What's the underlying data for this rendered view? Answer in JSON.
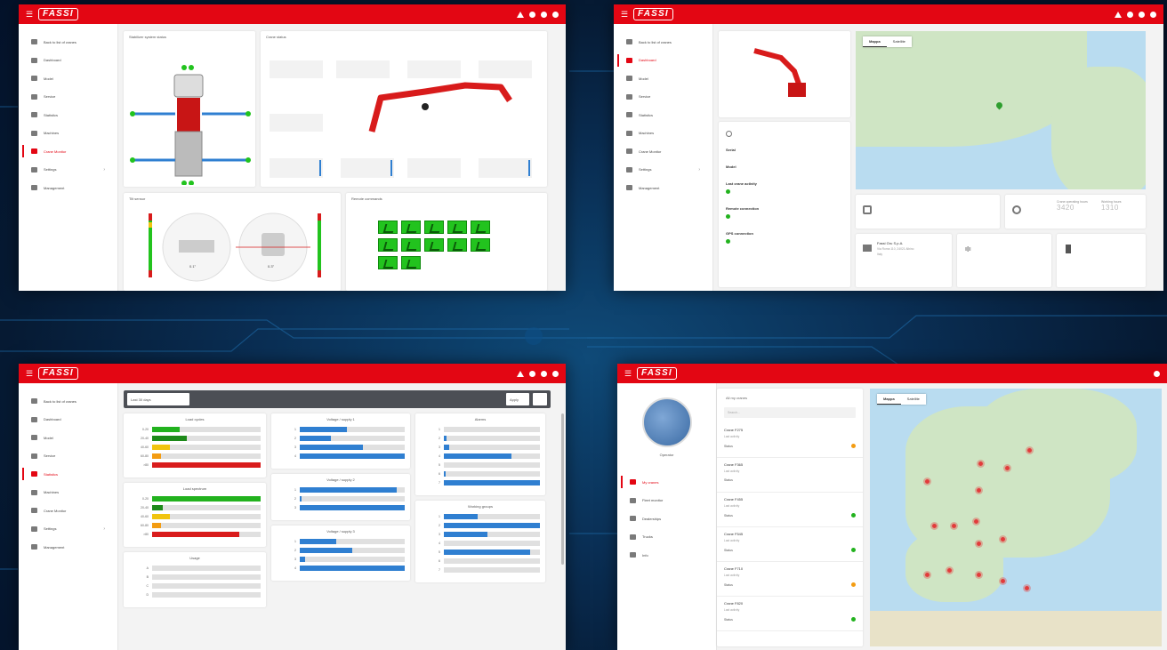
{
  "brand": {
    "logo": "FASSI",
    "accent": "#e30613"
  },
  "sidebar_main": [
    {
      "label": "Back to list of cranes",
      "icon": "arrow-left-icon"
    },
    {
      "label": "Dashboard",
      "icon": "home-icon"
    },
    {
      "label": "Model",
      "icon": "model-icon"
    },
    {
      "label": "Service",
      "icon": "wrench-icon"
    },
    {
      "label": "Statistics",
      "icon": "chart-icon"
    },
    {
      "label": "Machines",
      "icon": "machine-icon"
    },
    {
      "label": "Crane Monitor",
      "icon": "crane-icon"
    },
    {
      "label": "Settings",
      "icon": "gear-icon"
    },
    {
      "label": "Management",
      "icon": "grid-icon"
    }
  ],
  "panel1": {
    "active_item": 6,
    "stabilizer_title": "Stabilizer system status",
    "crane_title": "Crane status",
    "tilt_title": "Tilt sensor",
    "tilt_values": [
      "0.1°",
      "0.3°"
    ],
    "remote_title": "Remote commands"
  },
  "panel2": {
    "active_item": 1,
    "map_tabs": [
      "Mappa",
      "Satellite"
    ],
    "info_labels": [
      "Serial",
      "Model",
      "Last crane activity",
      "Remote connection",
      "GPS connection"
    ],
    "stat_labels": [
      "Crane operating hours",
      "Working hours"
    ],
    "stat_values": [
      "3420",
      "1310"
    ],
    "dealer_title": "Fassi Gru S.p.A.",
    "dealer_lines": [
      "Via Roma 110, 24021 Albino",
      "Italy"
    ]
  },
  "panel3": {
    "active_item": 4,
    "toolbar_input": "Last 30 days",
    "toolbar_btn": "Apply",
    "charts": [
      {
        "title": "Load cycles",
        "rows": [
          {
            "label": "0-20",
            "value": 0.25,
            "color": "#22b21e"
          },
          {
            "label": "20-40",
            "value": 0.32,
            "color": "#1d8a1a"
          },
          {
            "label": "40-60",
            "value": 0.16,
            "color": "#f1c40f"
          },
          {
            "label": "60-80",
            "value": 0.08,
            "color": "#f39c12"
          },
          {
            "label": ">80",
            "value": 1.0,
            "color": "#d91c1c"
          }
        ]
      },
      {
        "title": "Load spectrum",
        "rows": [
          {
            "label": "0-20",
            "value": 1.0,
            "color": "#22b21e"
          },
          {
            "label": "20-40",
            "value": 0.1,
            "color": "#1d8a1a"
          },
          {
            "label": "40-60",
            "value": 0.16,
            "color": "#f1c40f"
          },
          {
            "label": "60-80",
            "value": 0.08,
            "color": "#f39c12"
          },
          {
            "label": ">80",
            "value": 0.8,
            "color": "#d91c1c"
          }
        ]
      },
      {
        "title": "Usage",
        "rows": [
          {
            "label": "A",
            "value": 0.0,
            "color": "#2f7fd1"
          },
          {
            "label": "B",
            "value": 0.0,
            "color": "#2f7fd1"
          },
          {
            "label": "C",
            "value": 0.0,
            "color": "#2f7fd1"
          },
          {
            "label": "D",
            "value": 0.0,
            "color": "#2f7fd1"
          }
        ]
      },
      {
        "title": "Voltage / supply 1",
        "rows": [
          {
            "label": "1",
            "value": 0.45,
            "color": "#2f7fd1"
          },
          {
            "label": "2",
            "value": 0.3,
            "color": "#2f7fd1"
          },
          {
            "label": "3",
            "value": 0.6,
            "color": "#2f7fd1"
          },
          {
            "label": "4",
            "value": 1.0,
            "color": "#2f7fd1"
          }
        ]
      },
      {
        "title": "Voltage / supply 2",
        "rows": [
          {
            "label": "1",
            "value": 0.92,
            "color": "#2f7fd1"
          },
          {
            "label": "2",
            "value": 0.02,
            "color": "#2f7fd1"
          },
          {
            "label": "3",
            "value": 1.0,
            "color": "#2f7fd1"
          }
        ]
      },
      {
        "title": "Voltage / supply 3",
        "rows": [
          {
            "label": "1",
            "value": 0.35,
            "color": "#2f7fd1"
          },
          {
            "label": "2",
            "value": 0.5,
            "color": "#2f7fd1"
          },
          {
            "label": "3",
            "value": 0.05,
            "color": "#2f7fd1"
          },
          {
            "label": "4",
            "value": 1.0,
            "color": "#2f7fd1"
          }
        ]
      },
      {
        "title": "Alarms",
        "rows": [
          {
            "label": "1",
            "value": 0.0,
            "color": "#2f7fd1"
          },
          {
            "label": "2",
            "value": 0.03,
            "color": "#2f7fd1"
          },
          {
            "label": "3",
            "value": 0.06,
            "color": "#2f7fd1"
          },
          {
            "label": "4",
            "value": 0.7,
            "color": "#2f7fd1"
          },
          {
            "label": "5",
            "value": 0.0,
            "color": "#2f7fd1"
          },
          {
            "label": "6",
            "value": 0.02,
            "color": "#2f7fd1"
          },
          {
            "label": "7",
            "value": 1.0,
            "color": "#2f7fd1"
          }
        ]
      },
      {
        "title": "Working groups",
        "rows": [
          {
            "label": "1",
            "value": 0.35,
            "color": "#2f7fd1"
          },
          {
            "label": "2",
            "value": 1.0,
            "color": "#2f7fd1"
          },
          {
            "label": "3",
            "value": 0.45,
            "color": "#2f7fd1"
          },
          {
            "label": "4",
            "value": 0.0,
            "color": "#2f7fd1"
          },
          {
            "label": "5",
            "value": 0.9,
            "color": "#2f7fd1"
          },
          {
            "label": "6",
            "value": 0.0,
            "color": "#2f7fd1"
          },
          {
            "label": "7",
            "value": 0.0,
            "color": "#2f7fd1"
          }
        ]
      }
    ]
  },
  "panel4": {
    "profile_name": "Operator",
    "menu": [
      {
        "label": "My cranes",
        "icon": "crane-icon"
      },
      {
        "label": "Fleet monitor",
        "icon": "fleet-icon"
      },
      {
        "label": "Dealerships",
        "icon": "dealer-icon"
      },
      {
        "label": "Trucks",
        "icon": "truck-icon"
      },
      {
        "label": "Info",
        "icon": "info-icon"
      }
    ],
    "search_placeholder": "Search...",
    "list_header": "All my cranes",
    "cranes": [
      {
        "title": "Crane F275",
        "sub": "Last activity",
        "status": "Status",
        "dot": "#f39c12"
      },
      {
        "title": "Crane F365",
        "sub": "Last activity",
        "status": "Status",
        "dot": ""
      },
      {
        "title": "Crane F455",
        "sub": "Last activity",
        "status": "Status",
        "dot": "#22b21e"
      },
      {
        "title": "Crane F545",
        "sub": "Last activity",
        "status": "Status",
        "dot": "#22b21e"
      },
      {
        "title": "Crane F710",
        "sub": "Last activity",
        "status": "Status",
        "dot": "#f39c12"
      },
      {
        "title": "Crane F820",
        "sub": "Last activity",
        "status": "Status",
        "dot": "#22b21e"
      }
    ],
    "map_tabs": [
      "Mappa",
      "Satellite"
    ]
  }
}
